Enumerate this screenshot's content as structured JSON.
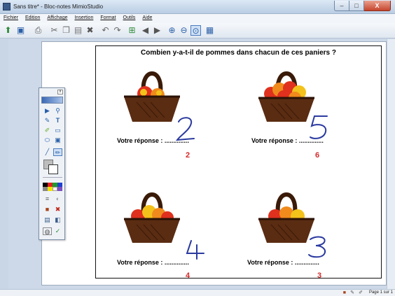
{
  "window": {
    "title": "Sans titre* - Bloc-notes MimioStudio",
    "min_label": "–",
    "max_label": "□",
    "close_label": "X"
  },
  "menu": [
    "Fichier",
    "Edition",
    "Affichage",
    "Insertion",
    "Format",
    "Outils",
    "Aide"
  ],
  "toolbar": {
    "icons": [
      "import-icon",
      "save-icon",
      "print-icon",
      "cut-icon",
      "copy-icon",
      "paste-icon",
      "delete-icon",
      "undo-icon",
      "redo-icon",
      "new-page-icon",
      "back-icon",
      "forward-icon",
      "zoom-in-icon",
      "zoom-out-icon",
      "zoom-fit-icon",
      "gallery-icon"
    ]
  },
  "page": {
    "question": "Combien y-a-t-il de pommes dans chacun de ces paniers ?",
    "prompt": "Votre réponse : ..............",
    "answers": [
      "2",
      "6",
      "4",
      "3"
    ],
    "handwritten": [
      "2",
      "5",
      "4",
      "3"
    ],
    "colors": {
      "answer": "#d42a2a",
      "handwriting": "#2b3aa0",
      "basket": "#5a2c12",
      "apple_red": "#e0301e",
      "apple_yellow": "#f3c21b"
    }
  },
  "palette": {
    "close_label": "x"
  },
  "status": {
    "page_label": "Page 1 sur 1"
  }
}
